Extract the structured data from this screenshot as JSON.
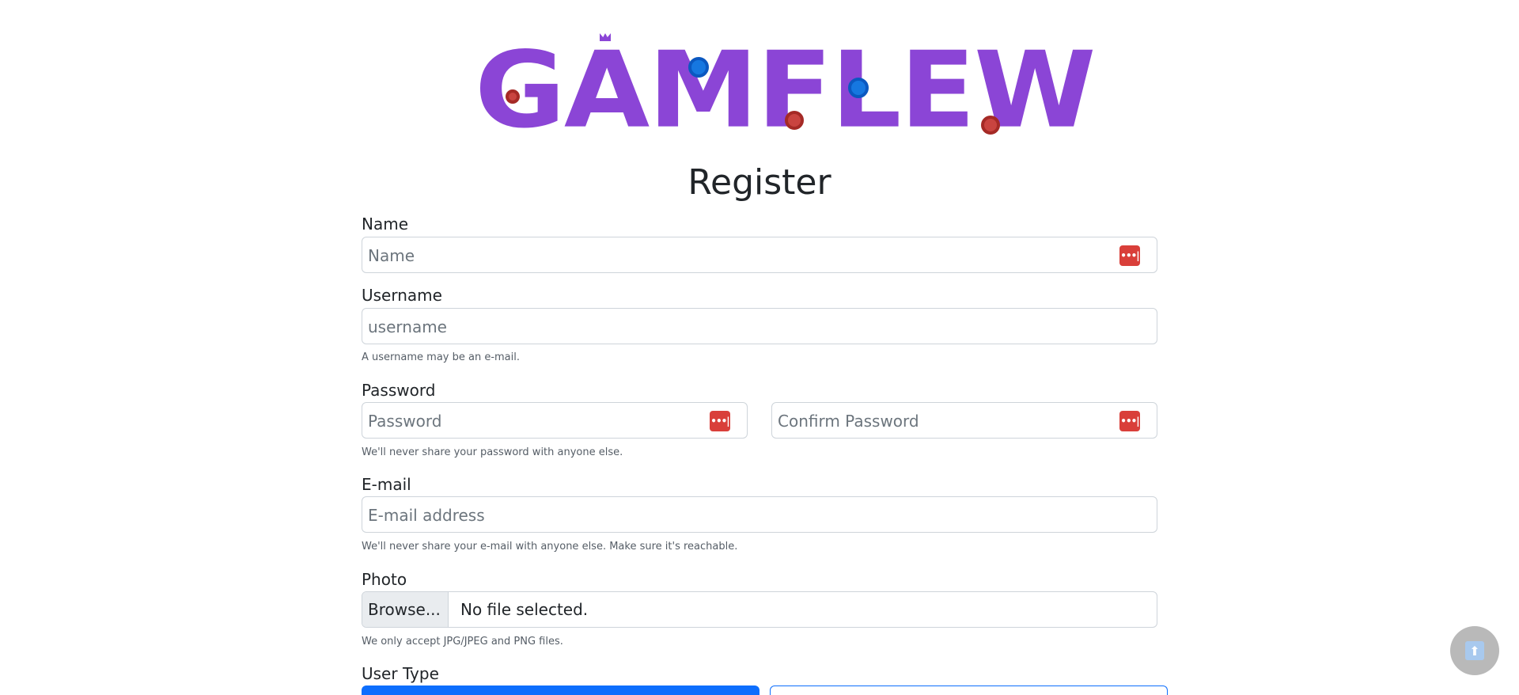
{
  "brand": {
    "logo_text": "GAMFLEW",
    "colors": {
      "purple": "#8b45d6",
      "blue": "#1677e0",
      "red": "#c94440"
    }
  },
  "page_title": "Register",
  "form": {
    "name": {
      "label": "Name",
      "placeholder": "Name"
    },
    "username": {
      "label": "Username",
      "placeholder": "username",
      "help": "A username may be an e-mail."
    },
    "password": {
      "label": "Password",
      "placeholder": "Password",
      "confirm_placeholder": "Confirm Password",
      "help": "We'll never share your password with anyone else."
    },
    "email": {
      "label": "E-mail",
      "placeholder": "E-mail address",
      "help": "We'll never share your e-mail with anyone else. Make sure it's reachable."
    },
    "photo": {
      "label": "Photo",
      "browse_label": "Browse...",
      "status": "No file selected.",
      "help": "We only accept JPG/JPEG and PNG files."
    },
    "user_type": {
      "label": "User Type"
    }
  },
  "password_manager_icon": {
    "glyph": "•••|",
    "color": "#d93f3a"
  },
  "scroll_top_icon": {
    "glyph": "⬆"
  }
}
